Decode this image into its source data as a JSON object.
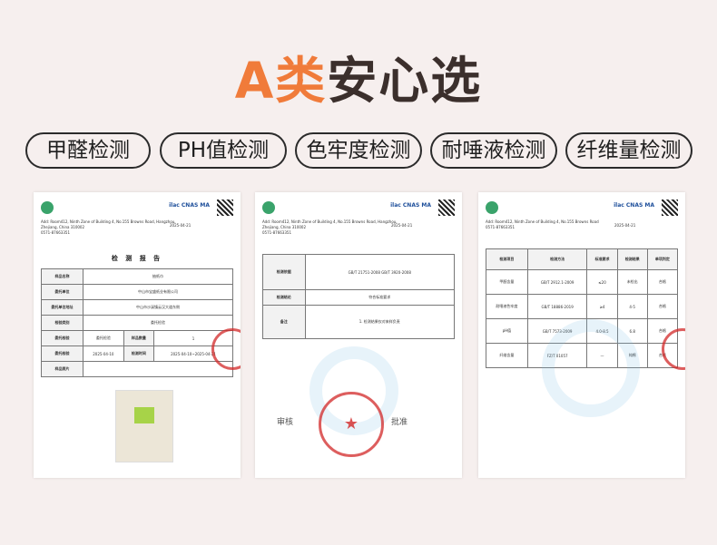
{
  "headline": {
    "accent": "A类",
    "rest": "安心选"
  },
  "tags": [
    "甲醛检测",
    "PH值检测",
    "色牢度检测",
    "耐唾液检测",
    "纤维量检测"
  ],
  "colors": {
    "accent": "#f07b3a",
    "background": "#f6efee",
    "stamp": "#d22828",
    "sample_mark": "#a7d348"
  },
  "doc1": {
    "address": "Add: Room412, Ninth Zone of Building 4, No.155 Browns Road, Hangzhou, Zhejiang, China 310002",
    "phone": "0571-87663351",
    "date": "2025-04-21",
    "title": "检 测 报 告",
    "rows": [
      [
        "样品名称",
        "抽纸巾"
      ],
      [
        "委托单位",
        "中山市宝盛纸业有限公司"
      ],
      [
        "委托单位地址",
        "中山市沙溪镇云汉大道东侧"
      ],
      [
        "检验类别",
        "委托检验"
      ]
    ],
    "row_a": [
      "委托检验",
      "样品数量",
      "1"
    ],
    "row_b": [
      "2025-04-10",
      "检测时间",
      "2025-04-10~2025-04-21"
    ],
    "section": "样品照片"
  },
  "doc2": {
    "address": "Add: Room412, Ninth Zone of Building 4, No.155 Browns Road, Hangzhou, Zhejiang, China 310002",
    "phone": "0571-87663351",
    "date": "2025-04-21",
    "rows": [
      [
        "检测依据",
        "GB/T 21751-2008 GB/T 3920-2008"
      ],
      [
        "检测结论",
        "符合标准要求"
      ],
      [
        "备注",
        "1. 检测结果仅对来样负责"
      ]
    ],
    "sig_left": "审核",
    "sig_right": "批准"
  },
  "doc3": {
    "address": "Add: Room412, Ninth Zone of Building 4, No.155 Browns Road",
    "phone": "0571-87663351",
    "date": "2025-04-21",
    "headers": [
      "检测项目",
      "检测方法",
      "标准要求",
      "检测结果",
      "单项判定"
    ],
    "rows": [
      [
        "甲醛含量",
        "GB/T 2912.1-2009",
        "≤20",
        "未检出",
        "合格"
      ],
      [
        "耐唾液色牢度",
        "GB/T 18886-2019",
        "≥4",
        "4-5",
        "合格"
      ],
      [
        "pH值",
        "GB/T 7573-2009",
        "4.0-8.5",
        "6.8",
        "合格"
      ],
      [
        "纤维含量",
        "FZ/T 01057",
        "—",
        "纯棉",
        "合格"
      ]
    ]
  }
}
